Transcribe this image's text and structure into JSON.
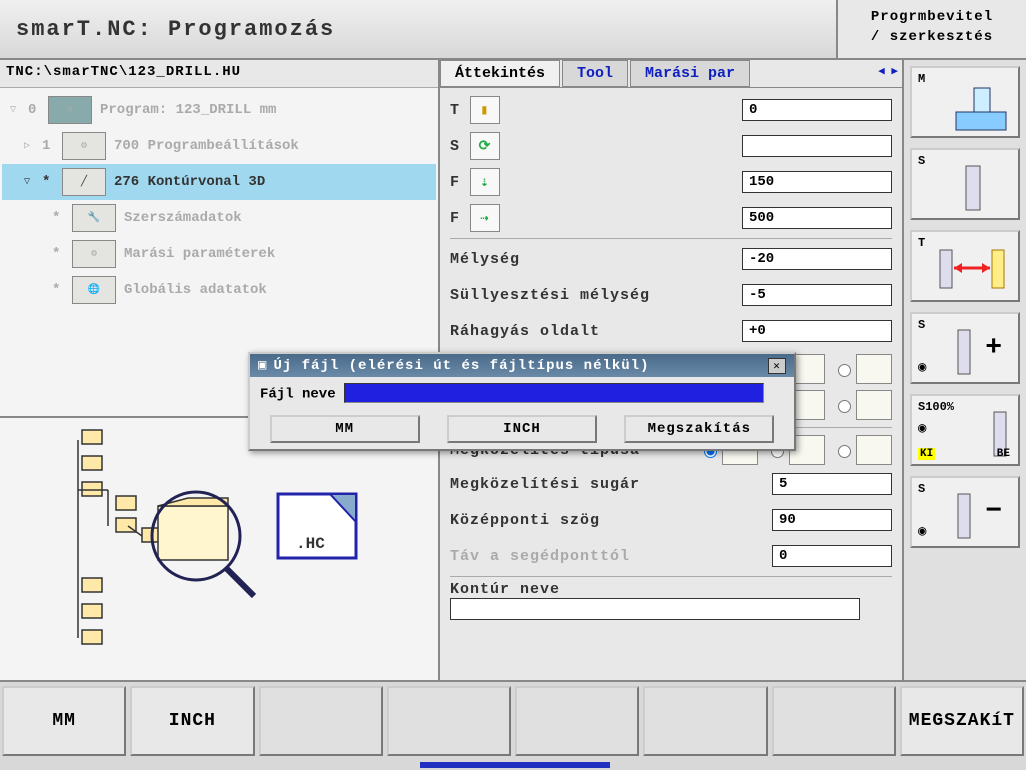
{
  "header": {
    "title": "smarT.NC: Programozás",
    "right_line1": "Progrmbevitel",
    "right_line2": "/ szerkesztés"
  },
  "path": "TNC:\\smarTNC\\123_DRILL.HU",
  "tree": [
    {
      "arrow": "▽",
      "num": "0",
      "icon": "prog",
      "label": "Program: 123_DRILL mm",
      "selected": false
    },
    {
      "arrow": "▷",
      "num": "1",
      "icon": "set",
      "label": "700 Programbeállítások",
      "selected": false
    },
    {
      "arrow": "▽",
      "num": "*",
      "icon": "cont",
      "label": "276 Kontúrvonal 3D",
      "selected": true
    },
    {
      "arrow": "",
      "num": "*",
      "icon": "tool",
      "label": "Szerszámadatok",
      "selected": false
    },
    {
      "arrow": "",
      "num": "*",
      "icon": "mill",
      "label": "Marási paraméterek",
      "selected": false
    },
    {
      "arrow": "",
      "num": "*",
      "icon": "glob",
      "label": "Globális adatatok",
      "selected": false
    }
  ],
  "hc_label": ".HC",
  "tabs": {
    "overview": "Áttekintés",
    "tool": "Tool",
    "milling": "Marási par"
  },
  "form": {
    "t_label": "T",
    "t_value": "0",
    "s_label": "S",
    "s_value": "",
    "f1_label": "F",
    "f1_value": "150",
    "f2_label": "F",
    "f2_value": "500",
    "depth_label": "Mélység",
    "depth_value": "-20",
    "sink_label": "Süllyesztési mélység",
    "sink_value": "-5",
    "side_label": "Ráhagyás oldalt",
    "side_value": "+0",
    "approach_type_label": "Megközelítés típusa",
    "approach_r_label": "Megközelítési sugár",
    "approach_r_value": "5",
    "center_ang_label": "Középponti szög",
    "center_ang_value": "90",
    "aux_dist_label": "Táv a segédponttól",
    "aux_dist_value": "0",
    "contour_name_label": "Kontúr neve",
    "contour_name_value": ""
  },
  "side": [
    {
      "lbl": "M"
    },
    {
      "lbl": "S"
    },
    {
      "lbl": "T",
      "arrow": true
    },
    {
      "lbl": "S",
      "glyph": "+"
    },
    {
      "lbl": "S100%",
      "ki": "KI",
      "be": "BE"
    },
    {
      "lbl": "S",
      "glyph": "−"
    }
  ],
  "dialog": {
    "title": "Új fájl (elérési út és fájltípus nélkül)",
    "field_label": "Fájl neve",
    "btn_mm": "MM",
    "btn_inch": "INCH",
    "btn_cancel": "Megszakítás"
  },
  "softkeys": {
    "mm": "MM",
    "inch": "INCH",
    "cancel": "MEGSZAKíT"
  }
}
